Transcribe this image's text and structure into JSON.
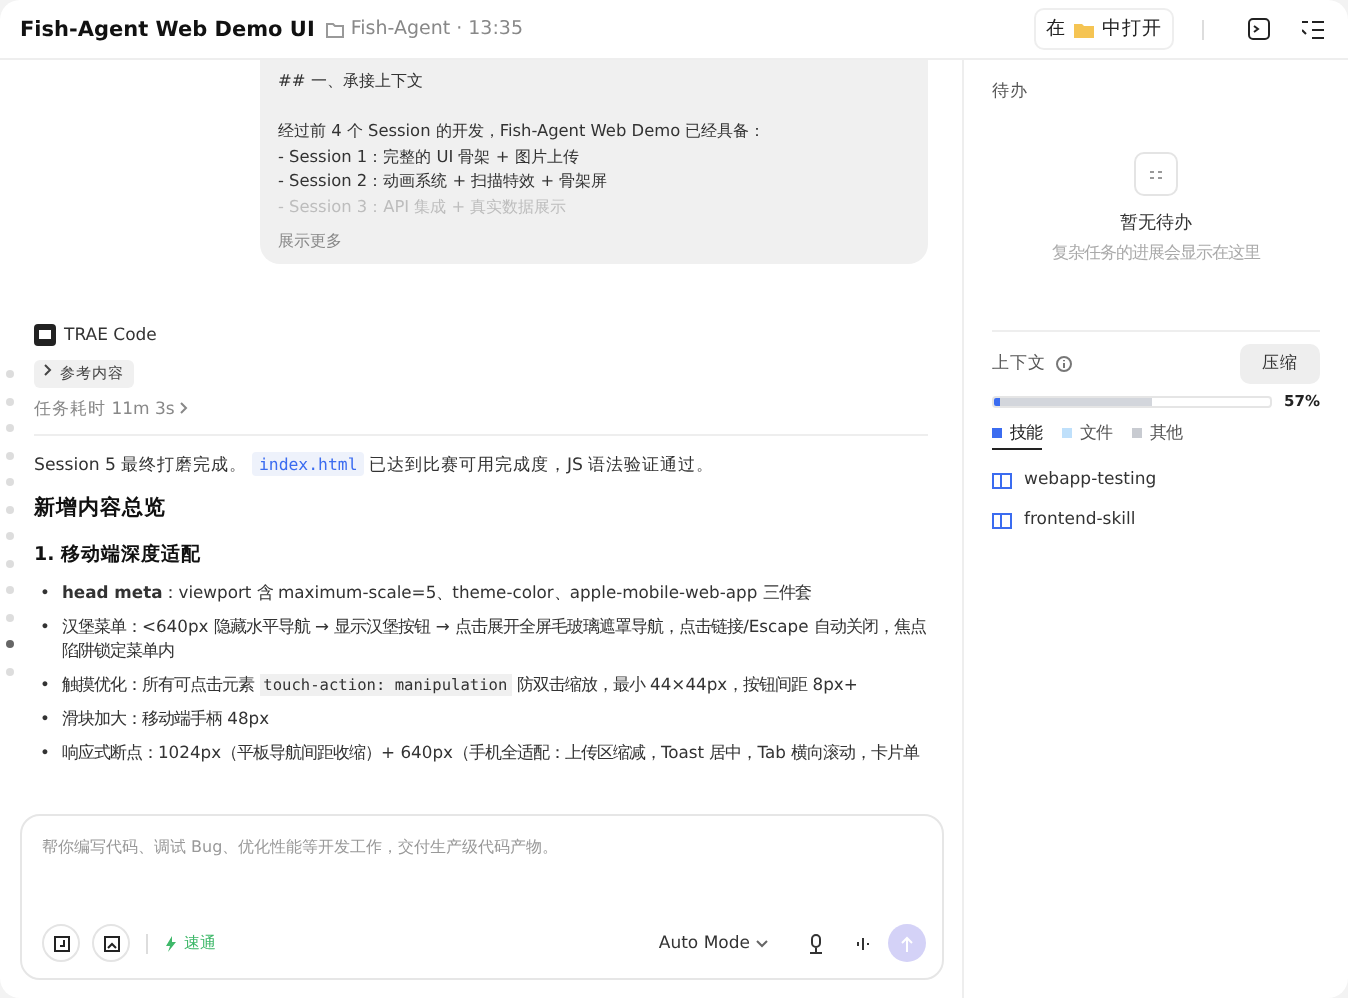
{
  "header": {
    "title": "Fish-Agent Web Demo UI",
    "project": "Fish-Agent · 13:35",
    "open_in": {
      "prefix": "在",
      "suffix": "中打开"
    }
  },
  "user_message": {
    "lines": [
      "## 一、承接上下文",
      "经过前 4 个 Session 的开发，Fish-Agent Web Demo 已经具备：",
      "- Session 1：完整的 UI 骨架 + 图片上传",
      "- Session 2：动画系统 + 扫描特效 + 骨架屏",
      "- Session 3：API 集成 + 真实数据展示"
    ],
    "show_more": "展示更多"
  },
  "timeline": [
    {
      "selected": false
    },
    {
      "selected": false
    },
    {
      "selected": false
    },
    {
      "selected": false
    },
    {
      "selected": false
    },
    {
      "selected": false
    },
    {
      "selected": false
    },
    {
      "selected": false
    },
    {
      "selected": false
    },
    {
      "selected": false
    },
    {
      "selected": true
    },
    {
      "selected": false
    }
  ],
  "agent": {
    "name": "TRAE Code",
    "reference": "参考内容",
    "elapsed": "任务耗时 11m 3s",
    "summary": [
      {
        "kind": "text",
        "text": "Session 5 最终打磨完成。"
      },
      {
        "kind": "code",
        "text": "index.html"
      },
      {
        "kind": "text",
        "text": "已达到比赛可用完成度，JS 语法验证通过。"
      }
    ],
    "heading": "新增内容总览",
    "subheading": "1. 移动端深度适配",
    "bullets": [
      {
        "marker": "•",
        "parts": [
          {
            "kind": "text",
            "text": "**head meta**：viewport 含 maximum-scale=5、theme-color、apple-mobile-web-app 三件套"
          }
        ]
      },
      {
        "marker": "•",
        "parts": [
          {
            "kind": "text",
            "text": "汉堡菜单：<640px 隐藏水平导航 → 显示汉堡按钮 → 点击展开全屏毛玻璃遮罩导航，点击链接/Escape 自动关闭，焦点陷阱锁定菜单内"
          }
        ]
      },
      {
        "marker": "•",
        "parts": [
          {
            "kind": "text",
            "text": "触摸优化：所有可点击元素"
          },
          {
            "kind": "code",
            "text": "touch-action: manipulation"
          },
          {
            "kind": "text",
            "text": "防双击缩放，最小 44×44px，按钮间距 8px+"
          }
        ]
      },
      {
        "marker": "•",
        "parts": [
          {
            "kind": "text",
            "text": "滑块加大：移动端手柄 48px"
          }
        ]
      },
      {
        "marker": "•",
        "parts": [
          {
            "kind": "text",
            "text": "响应式断点：1024px（平板导航间距收缩）+ 640px（手机全适配：上传区缩减，Toast 居中，Tab 横向滚动，卡片单"
          }
        ]
      }
    ]
  },
  "composer": {
    "placeholder": "帮你编写代码、调试 Bug、优化性能等开发工作，交付生产级代码产物。",
    "speed": "速通",
    "mode": "Auto Mode"
  },
  "todo": {
    "title": "待办",
    "empty_title": "暂无待办",
    "empty_hint": "复杂任务的进展会显示在这里"
  },
  "context": {
    "title": "上下文",
    "compress": "压缩",
    "percent": "57%",
    "segments": [
      {
        "color": "#3b6cf0",
        "level": 0.02
      },
      {
        "color": "#d3d6dc",
        "level": 0.55
      }
    ],
    "tabs": [
      {
        "label": "技能",
        "color": "#3b6cf0",
        "selected": true
      },
      {
        "label": "文件",
        "color": "#bfe0fb",
        "selected": false
      },
      {
        "label": "其他",
        "color": "#c8cbd1",
        "selected": false
      }
    ],
    "skills": [
      "webapp-testing",
      "frontend-skill"
    ]
  }
}
